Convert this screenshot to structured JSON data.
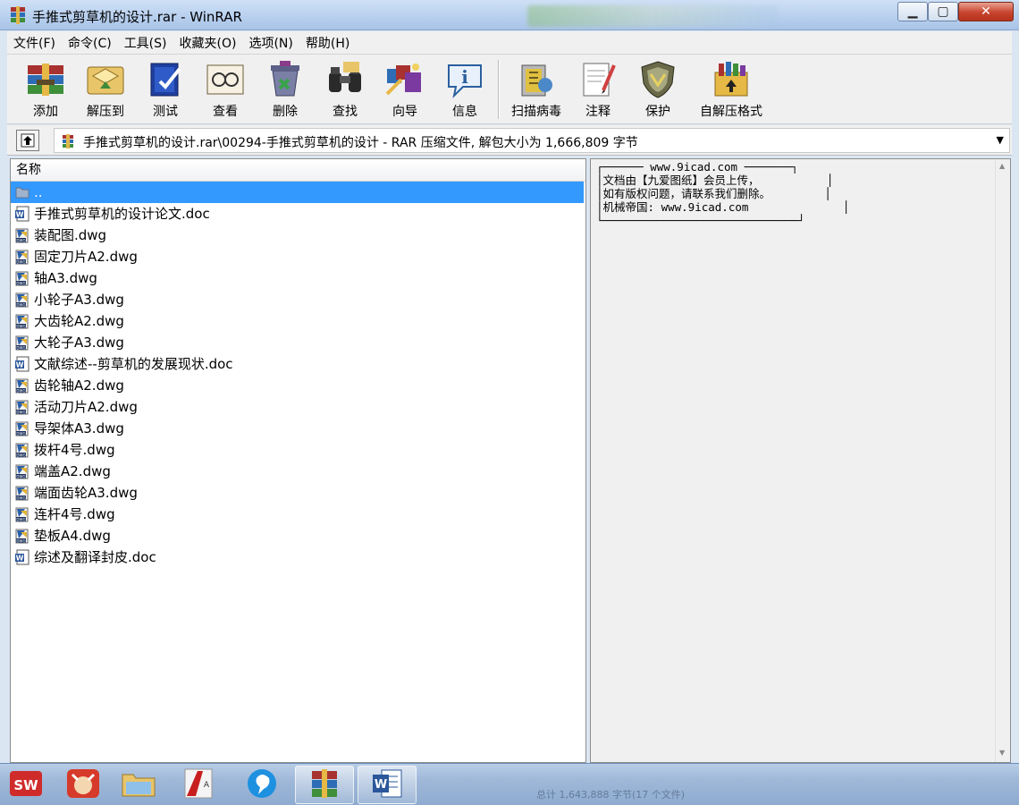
{
  "window": {
    "title": "手推式剪草机的设计.rar - WinRAR",
    "icons": {
      "app": "winrar-icon",
      "minimize": "minimize-icon",
      "maximize": "maximize-icon",
      "close": "close-icon"
    }
  },
  "menu": [
    {
      "label": "文件(F)"
    },
    {
      "label": "命令(C)"
    },
    {
      "label": "工具(S)"
    },
    {
      "label": "收藏夹(O)"
    },
    {
      "label": "选项(N)"
    },
    {
      "label": "帮助(H)"
    }
  ],
  "toolbar": [
    {
      "label": "添加",
      "icon": "add-archive-icon"
    },
    {
      "label": "解压到",
      "icon": "extract-to-icon"
    },
    {
      "label": "测试",
      "icon": "test-icon"
    },
    {
      "label": "查看",
      "icon": "view-icon"
    },
    {
      "label": "删除",
      "icon": "delete-icon"
    },
    {
      "label": "查找",
      "icon": "find-icon"
    },
    {
      "label": "向导",
      "icon": "wizard-icon"
    },
    {
      "label": "信息",
      "icon": "info-icon"
    },
    {
      "label": "扫描病毒",
      "icon": "virus-scan-icon"
    },
    {
      "label": "注释",
      "icon": "comment-icon"
    },
    {
      "label": "保护",
      "icon": "protect-icon"
    },
    {
      "label": "自解压格式",
      "icon": "sfx-icon"
    }
  ],
  "address": {
    "path": "手推式剪草机的设计.rar\\00294-手推式剪草机的设计 - RAR 压缩文件, 解包大小为 1,666,809 字节"
  },
  "filelist": {
    "column_name": "名称",
    "files": [
      {
        "name": "..",
        "type": "parent",
        "selected": true
      },
      {
        "name": "手推式剪草机的设计论文.doc",
        "type": "doc"
      },
      {
        "name": "装配图.dwg",
        "type": "dwg"
      },
      {
        "name": "固定刀片A2.dwg",
        "type": "dwg"
      },
      {
        "name": "轴A3.dwg",
        "type": "dwg"
      },
      {
        "name": "小轮子A3.dwg",
        "type": "dwg"
      },
      {
        "name": "大齿轮A2.dwg",
        "type": "dwg"
      },
      {
        "name": "大轮子A3.dwg",
        "type": "dwg"
      },
      {
        "name": "文献综述--剪草机的发展现状.doc",
        "type": "doc"
      },
      {
        "name": "齿轮轴A2.dwg",
        "type": "dwg"
      },
      {
        "name": "活动刀片A2.dwg",
        "type": "dwg"
      },
      {
        "name": "导架体A3.dwg",
        "type": "dwg"
      },
      {
        "name": "拨杆4号.dwg",
        "type": "dwg"
      },
      {
        "name": "端盖A2.dwg",
        "type": "dwg"
      },
      {
        "name": "端面齿轮A3.dwg",
        "type": "dwg"
      },
      {
        "name": "连杆4号.dwg",
        "type": "dwg"
      },
      {
        "name": "垫板A4.dwg",
        "type": "dwg"
      },
      {
        "name": "综述及翻译封皮.doc",
        "type": "doc"
      }
    ]
  },
  "comment": {
    "text": "┌────── www.9icad.com ───────┐\n│文档由【九爱图纸】会员上传，          │\n│如有版权问题，请联系我们删除。        │\n│机械帝国: www.9icad.com              │\n└─────────────────────────────┘"
  },
  "taskbar": [
    {
      "name": "solidworks-icon",
      "text": "SW"
    },
    {
      "name": "bull-app-icon",
      "text": ""
    },
    {
      "name": "file-explorer-icon",
      "text": ""
    },
    {
      "name": "autocad-icon",
      "text": "A"
    },
    {
      "name": "browser-icon",
      "text": ""
    },
    {
      "name": "winrar-task-icon",
      "text": "",
      "active": true
    },
    {
      "name": "word-icon",
      "text": "W",
      "active": true
    }
  ],
  "status_ghost": "总计 1,643,888 字节(17 个文件)"
}
